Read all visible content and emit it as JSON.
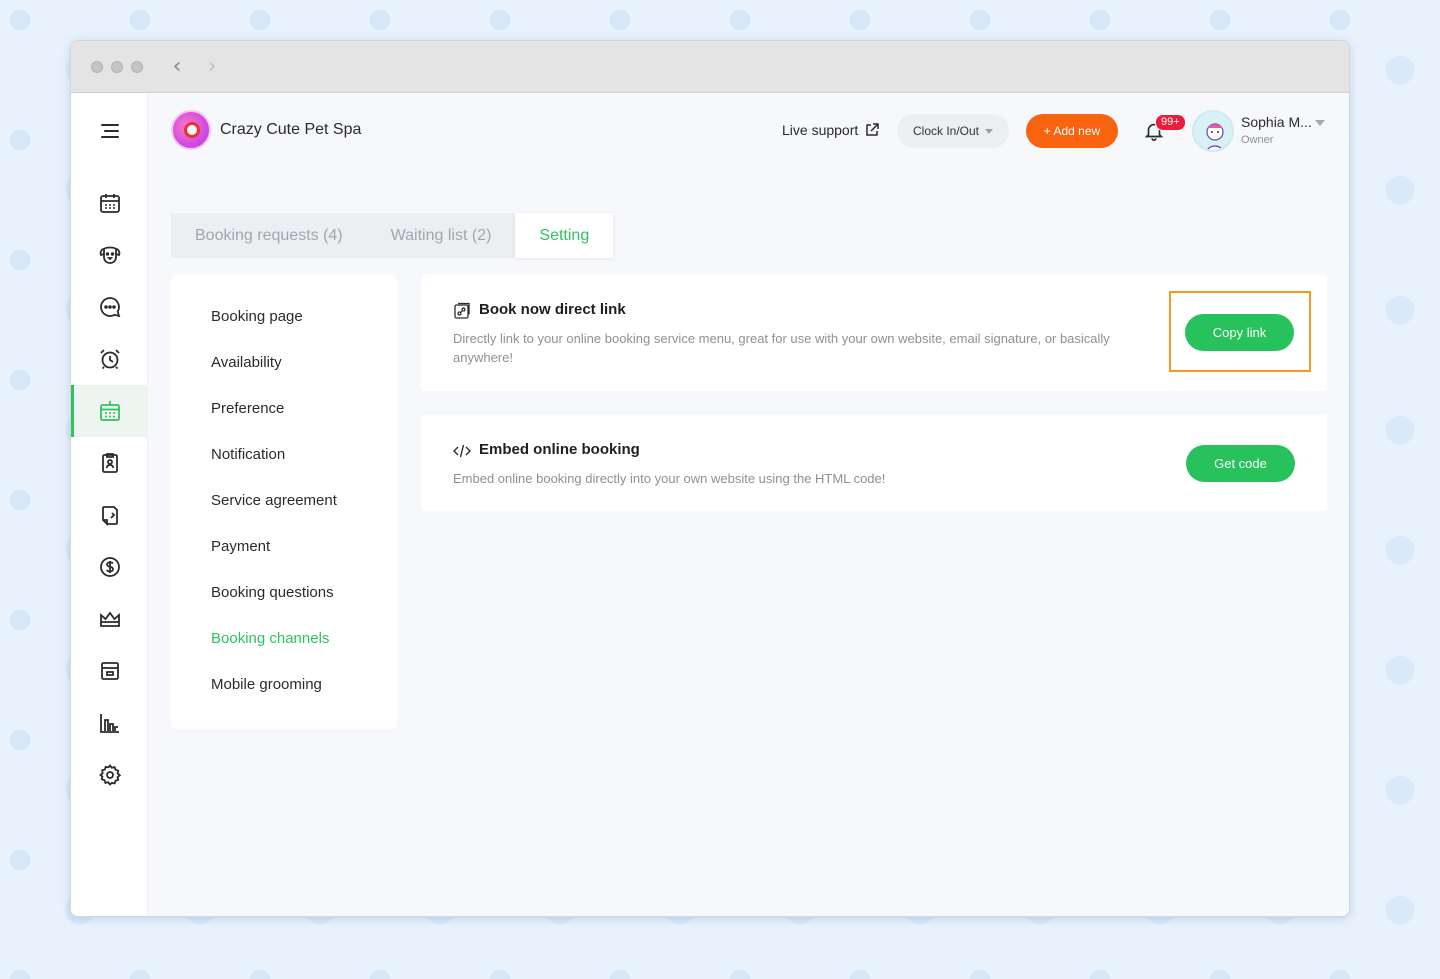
{
  "business": {
    "name": "Crazy Cute Pet Spa"
  },
  "header": {
    "live_support": "Live support",
    "clock_label": "Clock In/Out",
    "add_new_label": "+ Add new",
    "notification_badge": "99+",
    "user": {
      "name": "Sophia M...",
      "role": "Owner"
    }
  },
  "sidebar": {
    "items": [
      {
        "icon": "menu-icon"
      },
      {
        "icon": "calendar-icon"
      },
      {
        "icon": "dog-face-icon"
      },
      {
        "icon": "chat-icon"
      },
      {
        "icon": "alarm-clock-icon"
      },
      {
        "icon": "booking-calendar-icon",
        "active": true
      },
      {
        "icon": "clipboard-user-icon"
      },
      {
        "icon": "document-icon"
      },
      {
        "icon": "dollar-icon"
      },
      {
        "icon": "crown-icon"
      },
      {
        "icon": "retail-icon"
      },
      {
        "icon": "bar-chart-icon"
      },
      {
        "icon": "gear-icon"
      }
    ]
  },
  "tabs": [
    {
      "label": "Booking requests (4)"
    },
    {
      "label": "Waiting list (2)"
    },
    {
      "label": "Setting",
      "active": true
    }
  ],
  "settings_menu": [
    "Booking page",
    "Availability",
    "Preference",
    "Notification",
    "Service agreement",
    "Payment",
    "Booking questions",
    "Booking channels",
    "Mobile grooming"
  ],
  "settings_menu_active": "Booking channels",
  "cards": {
    "direct_link": {
      "title": "Book now direct link",
      "description": "Directly link to your online booking service menu, great for use with your own website, email signature, or basically anywhere!",
      "button": "Copy link"
    },
    "embed": {
      "title": "Embed online booking",
      "description": "Embed online booking directly into your own website using the HTML code!",
      "button": "Get code"
    }
  },
  "colors": {
    "accent_green": "#2fc260",
    "accent_orange": "#f9620f",
    "highlight_orange": "#f39a23",
    "badge_red": "#ed1c3b"
  }
}
